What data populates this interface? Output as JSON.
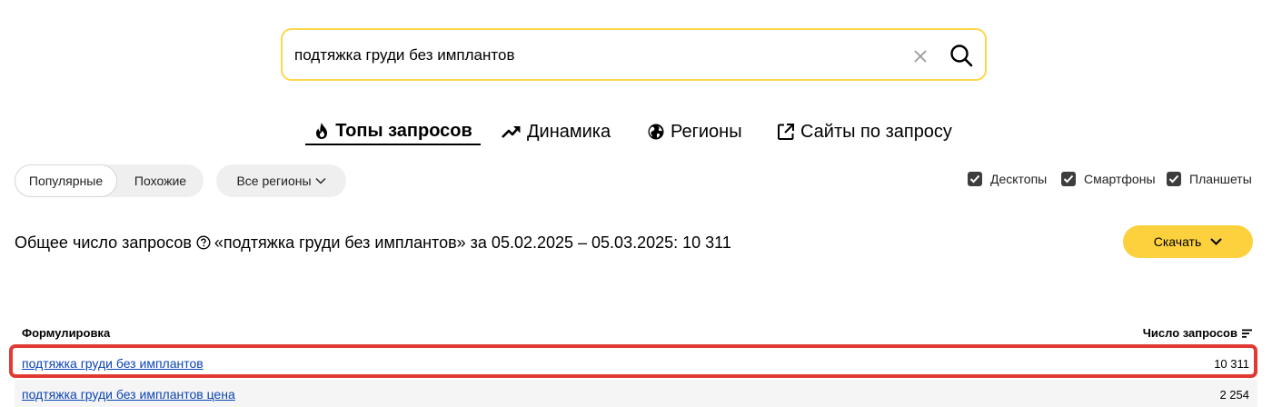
{
  "search": {
    "value": "подтяжка груди без имплантов"
  },
  "tabs": [
    {
      "label": "Топы запросов",
      "icon": "fire-icon",
      "active": true
    },
    {
      "label": "Динамика",
      "icon": "trend-icon",
      "active": false
    },
    {
      "label": "Регионы",
      "icon": "globe-icon",
      "active": false
    },
    {
      "label": "Сайты по запросу",
      "icon": "external-link-icon",
      "active": false
    }
  ],
  "filters": {
    "popular": "Популярные",
    "similar": "Похожие",
    "regions": "Все регионы",
    "devices": [
      {
        "label": "Десктопы",
        "checked": true
      },
      {
        "label": "Смартфоны",
        "checked": true
      },
      {
        "label": "Планшеты",
        "checked": true
      }
    ]
  },
  "summary": {
    "prefix": "Общее число запросов",
    "text": "«подтяжка груди без имплантов» за 05.02.2025 – 05.03.2025: 10 311"
  },
  "download_label": "Скачать",
  "table": {
    "headers": {
      "phrase": "Формулировка",
      "count": "Число запросов"
    },
    "rows": [
      {
        "phrase": "подтяжка груди без имплантов",
        "count": "10 311"
      },
      {
        "phrase": "подтяжка груди без имплантов цена",
        "count": "2 254"
      }
    ]
  },
  "colors": {
    "accent_yellow": "#fcd13d",
    "highlight_red": "#e03a33",
    "link_blue": "#0c44b5"
  }
}
